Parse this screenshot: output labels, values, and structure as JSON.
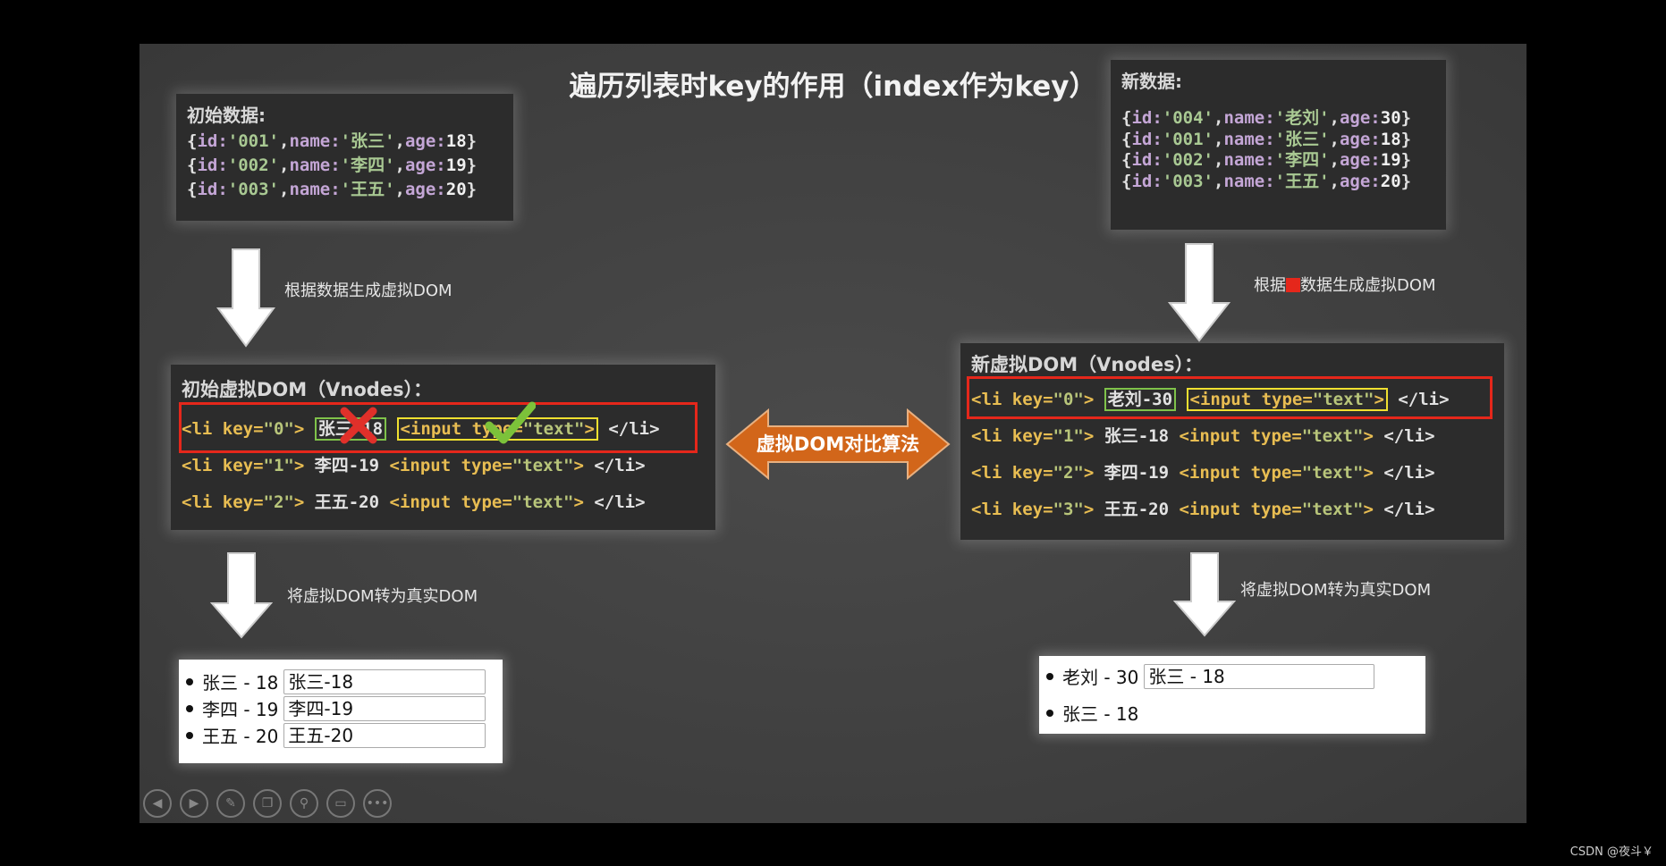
{
  "title": "遍历列表时key的作用（index作为key）",
  "initial_data": {
    "heading": "初始数据:",
    "rows": [
      {
        "id": "001",
        "name": "张三",
        "age": "18"
      },
      {
        "id": "002",
        "name": "李四",
        "age": "19"
      },
      {
        "id": "003",
        "name": "王五",
        "age": "20"
      }
    ]
  },
  "new_data": {
    "heading": "新数据:",
    "rows": [
      {
        "id": "004",
        "name": "老刘",
        "age": "30"
      },
      {
        "id": "001",
        "name": "张三",
        "age": "18"
      },
      {
        "id": "002",
        "name": "李四",
        "age": "19"
      },
      {
        "id": "003",
        "name": "王五",
        "age": "20"
      }
    ]
  },
  "arrows": {
    "left_generate": "根据数据生成虚拟DOM",
    "right_generate_a": "根据",
    "right_generate_b": "数据生成虚拟DOM",
    "left_render": "将虚拟DOM转为真实DOM",
    "right_render": "将虚拟DOM转为真实DOM",
    "compare": "虚拟DOM对比算法"
  },
  "initial_vdom": {
    "heading": "初始虚拟DOM（Vnodes）：",
    "rows": [
      {
        "key": "0",
        "text": "张三-18"
      },
      {
        "key": "1",
        "text": "李四-19"
      },
      {
        "key": "2",
        "text": "王五-20"
      }
    ]
  },
  "new_vdom": {
    "heading": "新虚拟DOM（Vnodes）：",
    "rows": [
      {
        "key": "0",
        "text": "老刘-30"
      },
      {
        "key": "1",
        "text": "张三-18"
      },
      {
        "key": "2",
        "text": "李四-19"
      },
      {
        "key": "3",
        "text": "王五-20"
      }
    ]
  },
  "input_tag": "<input type=\"text\">",
  "close_tag": "</li>",
  "initial_real_dom": [
    {
      "label": "张三 - 18",
      "input": "张三-18"
    },
    {
      "label": "李四 - 19",
      "input": "李四-19"
    },
    {
      "label": "王五 - 20",
      "input": "王五-20"
    }
  ],
  "new_real_dom": [
    {
      "label": "老刘 - 30",
      "input": "张三 - 18"
    },
    {
      "label": "张三 - 18"
    }
  ],
  "toolbar": [
    "prev-icon",
    "next-icon",
    "pen-icon",
    "slides-icon",
    "zoom-icon",
    "screen-icon",
    "more-icon"
  ],
  "watermark": "CSDN @夜斗￥",
  "colors": {
    "highlight_red": "#e5271b",
    "text_box_green": "#7fc24a",
    "input_box_yellow": "#f0e030",
    "compare_arrow": "#d2661a"
  }
}
